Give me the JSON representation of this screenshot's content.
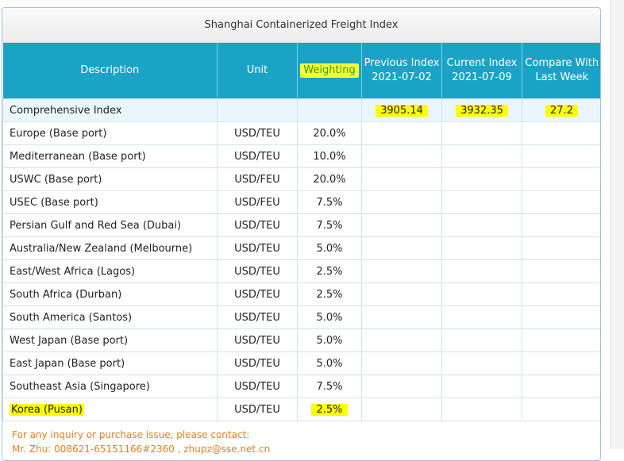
{
  "panel": {
    "title": "Shanghai Containerized Freight Index"
  },
  "table": {
    "headers": {
      "description": "Description",
      "unit": "Unit",
      "weighting": "Weighting",
      "previous_line1": "Previous Index",
      "previous_line2": "2021-07-02",
      "current_line1": "Current Index",
      "current_line2": "2021-07-09",
      "compare_line1": "Compare With",
      "compare_line2": "Last Week"
    },
    "rows": [
      {
        "description": "Comprehensive Index",
        "unit": "",
        "weighting": "",
        "previous": "3905.14",
        "current": "3932.35",
        "compare": "27.2"
      },
      {
        "description": "Europe (Base port)",
        "unit": "USD/TEU",
        "weighting": "20.0%",
        "previous": "",
        "current": "",
        "compare": ""
      },
      {
        "description": "Mediterranean (Base port)",
        "unit": "USD/TEU",
        "weighting": "10.0%",
        "previous": "",
        "current": "",
        "compare": ""
      },
      {
        "description": "USWC (Base port)",
        "unit": "USD/FEU",
        "weighting": "20.0%",
        "previous": "",
        "current": "",
        "compare": ""
      },
      {
        "description": "USEC (Base port)",
        "unit": "USD/FEU",
        "weighting": "7.5%",
        "previous": "",
        "current": "",
        "compare": ""
      },
      {
        "description": "Persian Gulf and Red Sea (Dubai)",
        "unit": "USD/TEU",
        "weighting": "7.5%",
        "previous": "",
        "current": "",
        "compare": ""
      },
      {
        "description": "Australia/New Zealand (Melbourne)",
        "unit": "USD/TEU",
        "weighting": "5.0%",
        "previous": "",
        "current": "",
        "compare": ""
      },
      {
        "description": "East/West Africa (Lagos)",
        "unit": "USD/TEU",
        "weighting": "2.5%",
        "previous": "",
        "current": "",
        "compare": ""
      },
      {
        "description": "South Africa (Durban)",
        "unit": "USD/TEU",
        "weighting": "2.5%",
        "previous": "",
        "current": "",
        "compare": ""
      },
      {
        "description": "South America (Santos)",
        "unit": "USD/TEU",
        "weighting": "5.0%",
        "previous": "",
        "current": "",
        "compare": ""
      },
      {
        "description": "West Japan (Base port)",
        "unit": "USD/TEU",
        "weighting": "5.0%",
        "previous": "",
        "current": "",
        "compare": ""
      },
      {
        "description": "East Japan (Base port)",
        "unit": "USD/TEU",
        "weighting": "5.0%",
        "previous": "",
        "current": "",
        "compare": ""
      },
      {
        "description": "Southeast Asia (Singapore)",
        "unit": "USD/TEU",
        "weighting": "7.5%",
        "previous": "",
        "current": "",
        "compare": ""
      },
      {
        "description": "Korea (Pusan)",
        "unit": "USD/TEU",
        "weighting": "2.5%",
        "previous": "",
        "current": "",
        "compare": ""
      }
    ]
  },
  "footer": {
    "line1": "For any inquiry or purchase issue, please contact:",
    "line2": "Mr. Zhu:    008621-65151166#2360 , zhupz@sse.net.cn"
  },
  "colors": {
    "header_bg": "#1ba3c7",
    "highlight": "#ffff00",
    "footer_text": "#e67e22"
  }
}
